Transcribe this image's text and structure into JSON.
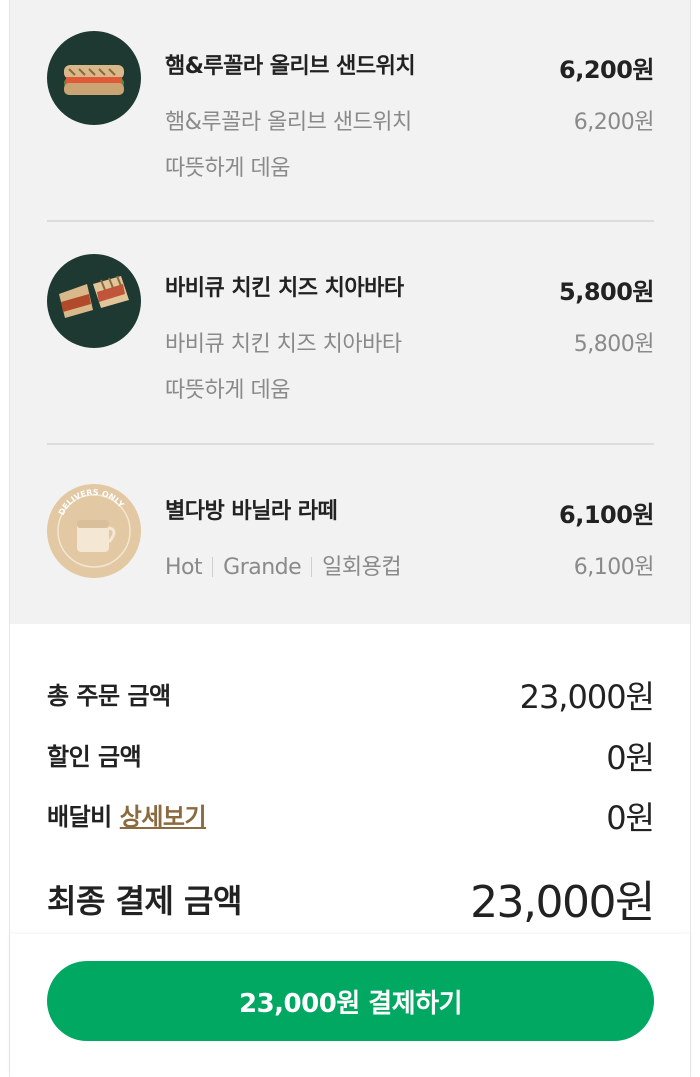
{
  "items": [
    {
      "name": "햄&루꼴라 올리브 샌드위치",
      "price": "6,200원",
      "option": "햄&루꼴라 올리브 샌드위치",
      "option_price": "6,200원",
      "warming": "따뜻하게 데움"
    },
    {
      "name": "바비큐 치킨 치즈 치아바타",
      "price": "5,800원",
      "option": "바비큐 치킨 치즈 치아바타",
      "option_price": "5,800원",
      "warming": "따뜻하게 데움"
    },
    {
      "name": "별다방 바닐라 라떼",
      "price": "6,100원",
      "temp": "Hot",
      "size": "Grande",
      "cup": "일회용컵",
      "option_price": "6,100원",
      "badge_text": "DELIVERS ONLY"
    }
  ],
  "summary": {
    "total_label": "총 주문 금액",
    "total_value": "23,000원",
    "discount_label": "할인 금액",
    "discount_value": "0원",
    "delivery_label": "배달비",
    "delivery_link": "상세보기",
    "delivery_value": "0원",
    "final_label": "최종 결제 금액",
    "final_value": "23,000원"
  },
  "pay_button": "23,000원 결제하기",
  "colors": {
    "accent": "#00a862",
    "thumb_bg": "#1e3932",
    "link": "#8a6a3e",
    "items_bg": "#f2f2f2"
  }
}
